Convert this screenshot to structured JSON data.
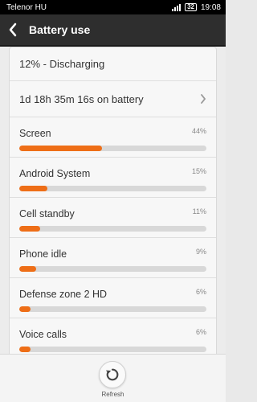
{
  "status_bar": {
    "carrier": "Telenor HU",
    "battery_level": "32",
    "time": "19:08"
  },
  "header": {
    "title": "Battery use",
    "back_icon": "back-chevron-icon"
  },
  "summary": {
    "status": "12% - Discharging",
    "on_battery": "1d 18h 35m 16s on battery"
  },
  "usage_items": [
    {
      "name": "Screen",
      "percent": "44%",
      "fraction": 0.44
    },
    {
      "name": "Android System",
      "percent": "15%",
      "fraction": 0.15
    },
    {
      "name": "Cell standby",
      "percent": "11%",
      "fraction": 0.11
    },
    {
      "name": "Phone idle",
      "percent": "9%",
      "fraction": 0.09
    },
    {
      "name": "Defense zone 2 HD",
      "percent": "6%",
      "fraction": 0.06
    },
    {
      "name": "Voice calls",
      "percent": "6%",
      "fraction": 0.06
    }
  ],
  "bottom": {
    "refresh_label": "Refresh",
    "refresh_icon": "refresh-icon"
  },
  "colors": {
    "accent": "#ee6e17",
    "header_bg": "#2e2e2e",
    "status_bar_bg": "#000000"
  }
}
